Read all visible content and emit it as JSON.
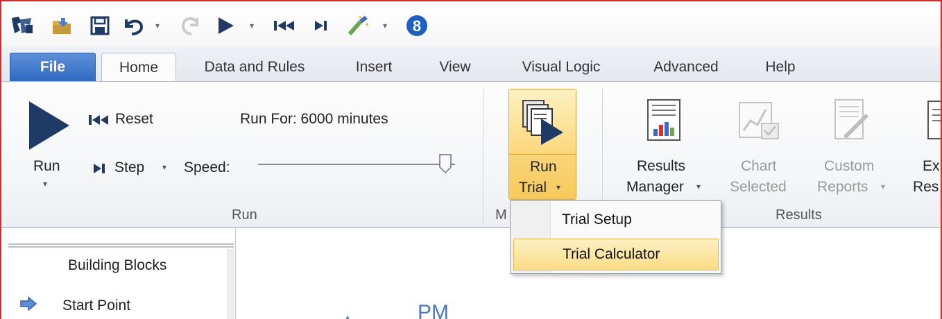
{
  "quick_access": {
    "icons": [
      "app-logo-icon",
      "open-folder-icon",
      "save-icon",
      "undo-icon",
      "redo-icon",
      "run-icon",
      "reset-icon",
      "step-icon",
      "wand-icon",
      "version-badge-icon"
    ],
    "version_badge": "8",
    "colors": {
      "brand_blue": "#1e5fc4",
      "accent_navy": "#1f3a64"
    }
  },
  "tabs": [
    {
      "label": "File"
    },
    {
      "label": "Home"
    },
    {
      "label": "Data and Rules"
    },
    {
      "label": "Insert"
    },
    {
      "label": "View"
    },
    {
      "label": "Visual Logic"
    },
    {
      "label": "Advanced"
    },
    {
      "label": "Help"
    }
  ],
  "ribbon": {
    "run_group": {
      "label": "Run",
      "run_label": "Run",
      "reset_label": "Reset",
      "step_label": "Step",
      "speed_label": "Speed:",
      "run_for": "Run For: 6000 minutes",
      "speed_level_percent": 95
    },
    "middle_group": {
      "label_visible": "M",
      "run_trial_line1": "Run",
      "run_trial_line2": "Trial"
    },
    "results_group": {
      "label": "Results",
      "results_manager_line1": "Results",
      "results_manager_line2": "Manager",
      "chart_selected_line1": "Chart",
      "chart_selected_line2": "Selected",
      "custom_reports_line1": "Custom",
      "custom_reports_line2": "Reports",
      "export_line1": "Ex",
      "export_line2": "Res"
    }
  },
  "dropdown": {
    "items": [
      {
        "label": "Trial Setup"
      },
      {
        "label": "Trial Calculator"
      }
    ]
  },
  "left_panel": {
    "title": "Building Blocks",
    "items": [
      {
        "label": "Start Point",
        "icon": "arrow-right-icon"
      }
    ]
  },
  "canvas": {
    "label": "PM"
  }
}
